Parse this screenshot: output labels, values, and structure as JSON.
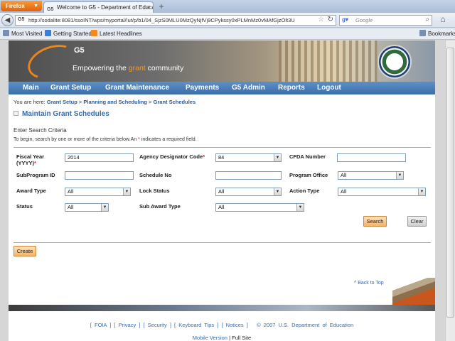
{
  "browser": {
    "menu_button": "Firefox",
    "tab_title": "Welcome to G5 - Department of Educatio...",
    "url": "http://sodalite:8081/ssoINT/wps/myportal/!ut/p/b1/04_SjzS0MLU0MzQyNjfVj9CPykssy0xPLMnMz0vMAfGjzOlt3U",
    "search_placeholder": "Google",
    "bookmarks": [
      "Most Visited",
      "Getting Started",
      "Latest Headlines"
    ],
    "bookmarks_menu": "Bookmarks"
  },
  "banner": {
    "logo_text": "G5",
    "tagline_prefix": "Empowering the ",
    "tagline_highlight": "grant",
    "tagline_suffix": " community"
  },
  "nav": [
    "Main",
    "Grant Setup",
    "Grant Maintenance",
    "Payments",
    "G5 Admin",
    "Reports",
    "Logout"
  ],
  "breadcrumb": {
    "prefix": "You are here:",
    "items": [
      "Grant Setup",
      "Planning and Scheduling",
      "Grant Schedules"
    ],
    "separator": ">"
  },
  "page_title": "Maintain Grant Schedules",
  "section_label": "Enter Search Criteria",
  "hint": {
    "before": "To begin, search by one or more of the criteria below.An ",
    "star": "*",
    "after": " indicates a required field."
  },
  "form": {
    "fiscal_year": {
      "label_line1": "Fiscal Year",
      "label_line2": "(YYYY)",
      "required": "*",
      "value": "2014"
    },
    "agency_code": {
      "label": "Agency Designator Code",
      "required": "*",
      "value": "84"
    },
    "cfda_number": {
      "label": "CFDA Number",
      "value": ""
    },
    "subprogram_id": {
      "label": "SubProgram ID",
      "value": ""
    },
    "schedule_no": {
      "label": "Schedule No",
      "value": ""
    },
    "program_office": {
      "label": "Program Office",
      "value": "All"
    },
    "award_type": {
      "label": "Award Type",
      "value": "All"
    },
    "lock_status": {
      "label": "Lock Status",
      "value": "All"
    },
    "action_type": {
      "label": "Action Type",
      "value": "All"
    },
    "status": {
      "label": "Status",
      "value": "All"
    },
    "sub_award_type": {
      "label": "Sub Award Type",
      "value": "All"
    }
  },
  "buttons": {
    "search": "Search",
    "clear": "Clear",
    "create": "Create"
  },
  "back_to_top": "^ Back to Top",
  "footer": {
    "links": [
      "FOIA",
      "Privacy",
      "Security",
      "Keyboard Tips",
      "Notices"
    ],
    "copyright": "© 2007 U.S. Department of Education",
    "mobile_version": "Mobile Version",
    "full_site": "Full Site"
  }
}
